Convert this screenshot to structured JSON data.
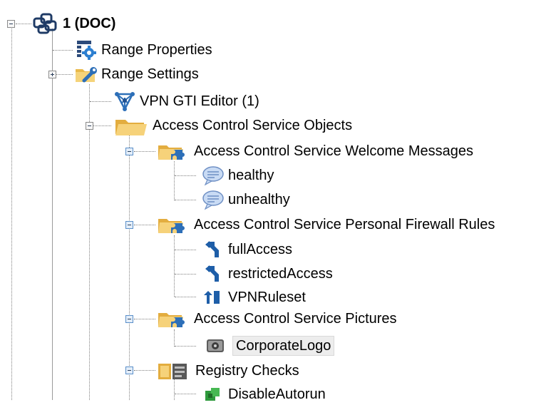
{
  "tree": {
    "root": {
      "label": "1 (DOC)",
      "icon": "domain-cluster-icon"
    },
    "range_properties": {
      "label": "Range Properties",
      "icon": "range-properties-icon"
    },
    "range_settings": {
      "label": "Range Settings",
      "icon": "folder-wrench-icon"
    },
    "vpn_gti_editor": {
      "label": "VPN GTI Editor (1)",
      "icon": "vpn-network-icon"
    },
    "acs_objects": {
      "label": "Access Control Service Objects",
      "icon": "folder-open-icon"
    },
    "welcome_messages": {
      "label": "Access Control Service Welcome Messages",
      "icon": "folder-puzzle-icon",
      "items": [
        {
          "label": "healthy",
          "icon": "speech-bubble-icon"
        },
        {
          "label": "unhealthy",
          "icon": "speech-bubble-icon"
        }
      ]
    },
    "firewall_rules": {
      "label": "Access Control Service Personal Firewall Rules",
      "icon": "folder-puzzle-icon",
      "items": [
        {
          "label": "fullAccess",
          "icon": "ruleset-icon"
        },
        {
          "label": "restrictedAccess",
          "icon": "ruleset-icon"
        },
        {
          "label": "VPNRuleset",
          "icon": "ruleset-icon"
        }
      ]
    },
    "pictures": {
      "label": "Access Control Service Pictures",
      "icon": "folder-puzzle-icon",
      "items": [
        {
          "label": "CorporateLogo",
          "icon": "picture-icon"
        }
      ]
    },
    "registry_checks": {
      "label": "Registry Checks",
      "icon": "registry-folder-icon",
      "items": [
        {
          "label": "DisableAutorun",
          "icon": "registry-check-icon"
        }
      ]
    }
  },
  "colors": {
    "selection_bg": "#ededed",
    "folder_yellow": "#f2c45a",
    "icon_blue": "#2d6fb8"
  }
}
